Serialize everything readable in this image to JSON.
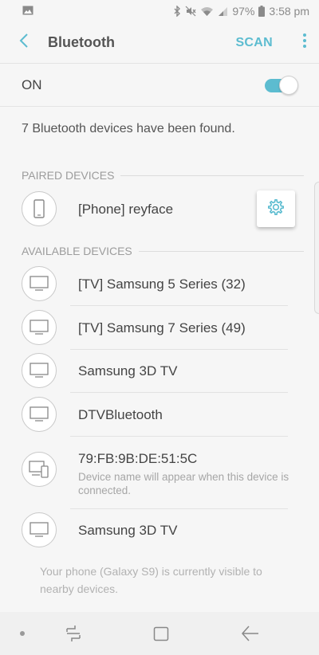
{
  "status_bar": {
    "battery": "97%",
    "time": "3:58 pm",
    "icons": [
      "image-icon",
      "bluetooth-icon",
      "mute-icon",
      "wifi-icon",
      "signal-icon",
      "battery-icon"
    ]
  },
  "app_bar": {
    "title": "Bluetooth",
    "scan_label": "SCAN"
  },
  "toggle": {
    "label": "ON",
    "state": true
  },
  "found_text": "7 Bluetooth devices have been found.",
  "paired": {
    "header": "PAIRED DEVICES",
    "devices": [
      {
        "name": "[Phone] reyface",
        "icon": "phone-icon"
      }
    ]
  },
  "available": {
    "header": "AVAILABLE DEVICES",
    "devices": [
      {
        "name": "[TV] Samsung 5 Series (32)",
        "icon": "tv-icon"
      },
      {
        "name": "[TV] Samsung 7 Series (49)",
        "icon": "tv-icon"
      },
      {
        "name": "Samsung 3D TV",
        "icon": "tv-icon"
      },
      {
        "name": "DTVBluetooth",
        "icon": "tv-icon"
      },
      {
        "name": "79:FB:9B:DE:51:5C",
        "subtitle": "Device name will appear when this device is connected.",
        "icon": "devices-icon"
      },
      {
        "name": "Samsung 3D TV",
        "icon": "tv-icon"
      }
    ]
  },
  "visible_note": "Your phone (Galaxy S9) is currently visible to nearby devices.",
  "colors": {
    "accent": "#5cbcd0",
    "background": "#f6f6f6",
    "nav_bar": "#f0f0f0"
  }
}
